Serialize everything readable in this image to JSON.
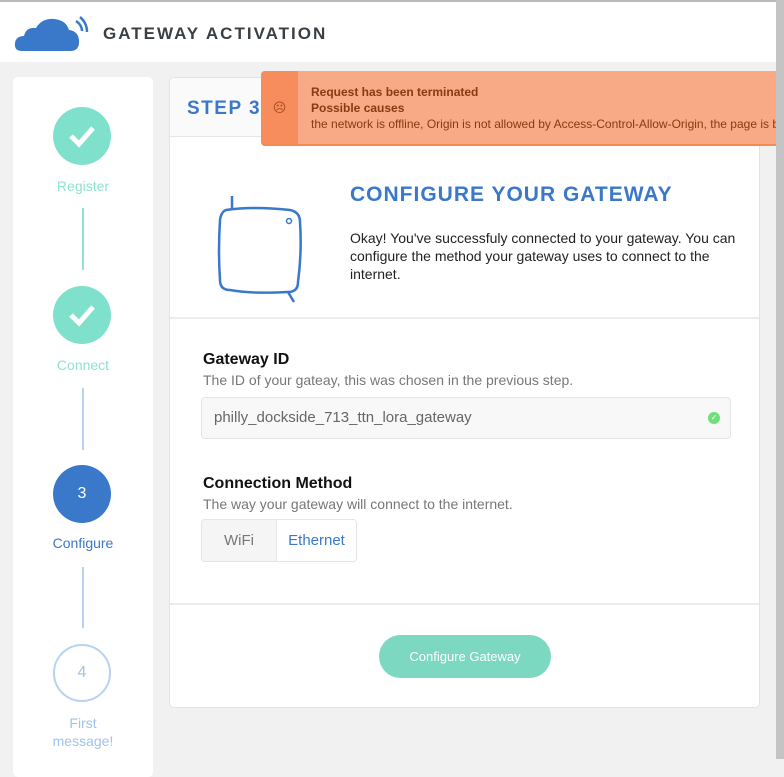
{
  "header": {
    "title": "GATEWAY ACTIVATION"
  },
  "steps": [
    {
      "label": "Register",
      "state": "done"
    },
    {
      "label": "Connect",
      "state": "done"
    },
    {
      "number": "3",
      "label": "Configure",
      "state": "current"
    },
    {
      "number": "4",
      "label": "First message!",
      "state": "todo"
    }
  ],
  "main": {
    "step_title": "STEP 3",
    "heading": "CONFIGURE YOUR GATEWAY",
    "intro": "Okay! You've successfuly connected to your gateway. You can configure the method your gateway uses to connect to the internet.",
    "gateway_id": {
      "label": "Gateway ID",
      "hint": "The ID of your gateay, this was chosen in the previous step.",
      "value": "philly_dockside_713_ttn_lora_gateway",
      "valid": true
    },
    "connection": {
      "label": "Connection Method",
      "hint": "The way your gateway will connect to the internet.",
      "options": [
        "WiFi",
        "Ethernet"
      ],
      "selected": "Ethernet"
    },
    "submit": "Configure Gateway"
  },
  "toast": {
    "title": "Request has been terminated",
    "subtitle": "Possible causes",
    "message": "the network is offline, Origin is not allowed by Access-Control-Allow-Origin, the page is being unloaded, etc."
  },
  "colors": {
    "brand": "#3a78c9",
    "success": "#7fe0cc",
    "toast": "#f8a986"
  }
}
